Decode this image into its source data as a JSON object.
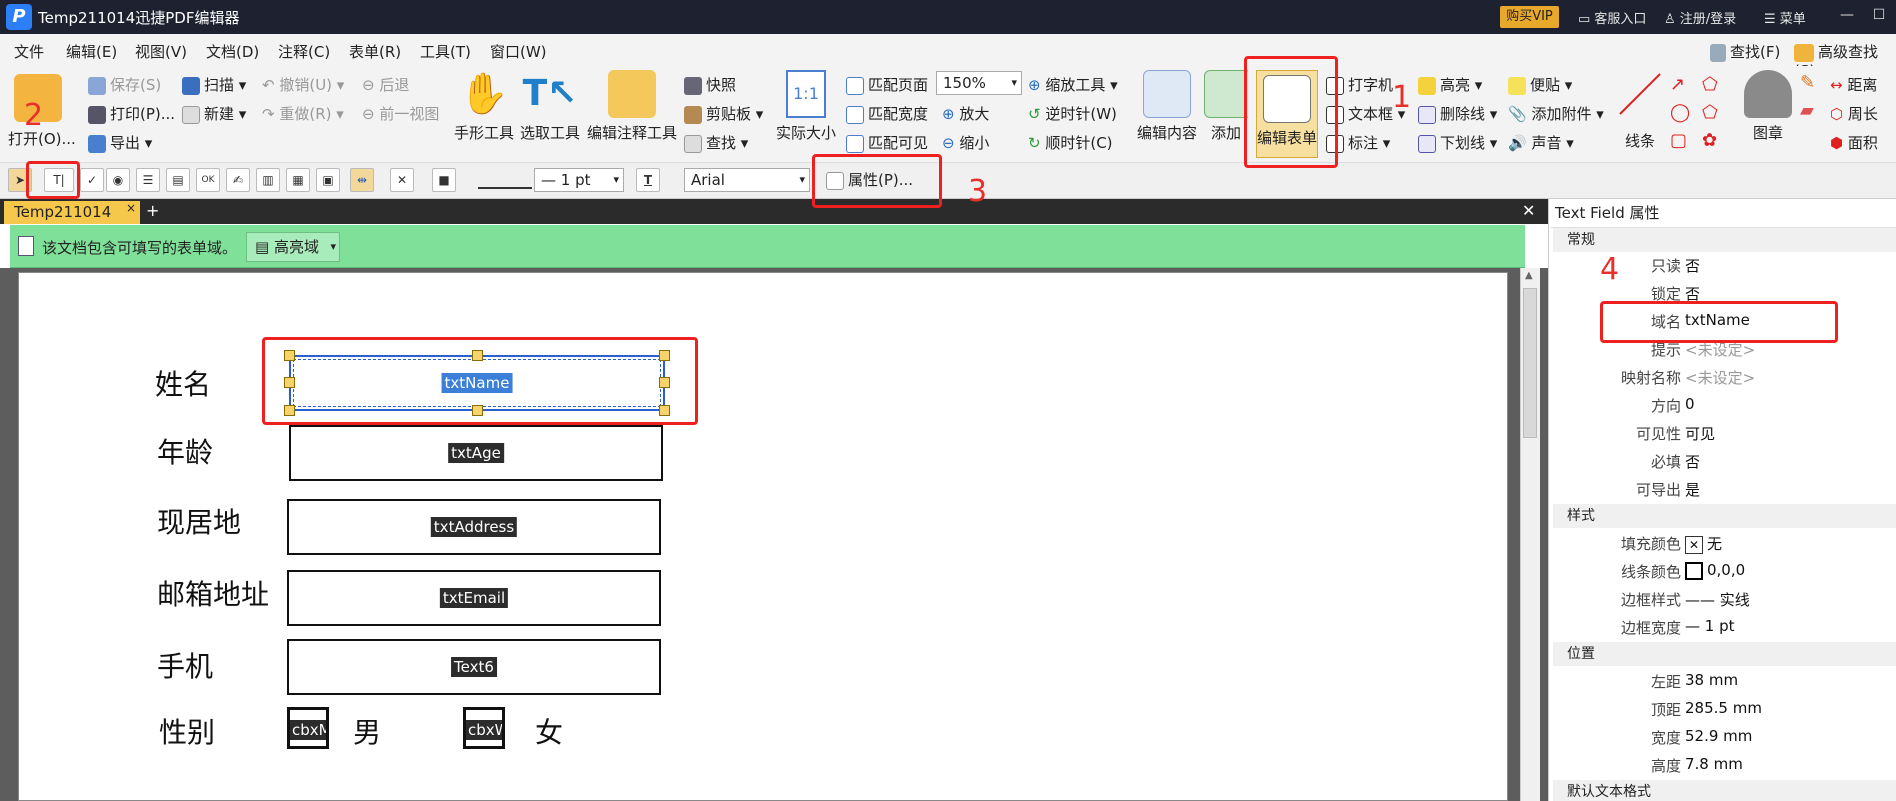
{
  "app": {
    "logo": "P",
    "title": "Temp211014迅捷PDF编辑器",
    "vip": "购买VIP",
    "service": "客服入口",
    "login": "注册/登录",
    "menu": "菜单"
  },
  "menubar": [
    "文件",
    "编辑(E)",
    "视图(V)",
    "文档(D)",
    "注释(C)",
    "表单(R)",
    "工具(T)",
    "窗口(W)"
  ],
  "menubar_right": {
    "find": "查找(F)",
    "adv_find": "高级查找(S)"
  },
  "ribbon": {
    "open": "打开(O)...",
    "save": "保存(S)",
    "print": "打印(P)...",
    "export": "导出",
    "scan": "扫描",
    "new": "新建",
    "undo": "撤销(U)",
    "redo": "重做(R)",
    "back": "后退",
    "prev_view": "前一视图",
    "hand": "手形工具",
    "select": "选取工具",
    "annot_select": "编辑注释工具",
    "snapshot": "快照",
    "clipboard": "剪贴板",
    "search": "查找",
    "actual": "实际大小",
    "fit_page": "匹配页面",
    "fit_width": "匹配宽度",
    "fit_visible": "匹配可见",
    "zoom": "150%",
    "zoom_tool": "缩放工具",
    "zoom_in": "放大",
    "zoom_out": "缩小",
    "ccw": "逆时针(W)",
    "cw": "顺时针(C)",
    "edit_content": "编辑内容",
    "add": "添加",
    "edit_form": "编辑表单",
    "typewriter": "打字机",
    "textbox": "文本框",
    "callout": "标注",
    "highlight": "高亮",
    "strike": "删除线",
    "underline": "下划线",
    "note": "便贴",
    "attach": "添加附件",
    "sound": "声音",
    "line": "线条",
    "stamp": "图章",
    "distance": "距离",
    "perimeter": "周长",
    "area": "面积"
  },
  "fmtbar": {
    "line_width": "— 1 pt",
    "font": "Arial",
    "properties": "属性(P)..."
  },
  "doc": {
    "tab": "Temp211014",
    "notice": "该文档包含可填写的表单域。",
    "highlight_btn": "高亮域",
    "labels": [
      "姓名",
      "年龄",
      "现居地",
      "邮箱地址",
      "手机",
      "性别"
    ],
    "fields": [
      "txtName",
      "txtAge",
      "txtAddress",
      "txtEmail",
      "Text6"
    ],
    "checkboxes": [
      "cbxM",
      "cbxW"
    ],
    "genders": [
      "男",
      "女"
    ]
  },
  "annotations": [
    "1",
    "2",
    "3",
    "4"
  ],
  "props": {
    "title": "Text Field 属性",
    "sections": [
      "常规",
      "样式",
      "位置",
      "默认文本格式"
    ],
    "general": [
      {
        "k": "只读",
        "v": "否"
      },
      {
        "k": "锁定",
        "v": "否"
      },
      {
        "k": "域名",
        "v": "txtName"
      },
      {
        "k": "提示",
        "v": "<未设定>"
      },
      {
        "k": "映射名称",
        "v": "<未设定>"
      },
      {
        "k": "方向",
        "v": "0"
      },
      {
        "k": "可见性",
        "v": "可见"
      },
      {
        "k": "必填",
        "v": "否"
      },
      {
        "k": "可导出",
        "v": "是"
      }
    ],
    "style": [
      {
        "k": "填充颜色",
        "v": "无"
      },
      {
        "k": "线条颜色",
        "v": "0,0,0"
      },
      {
        "k": "边框样式",
        "v": "—— 实线"
      },
      {
        "k": "边框宽度",
        "v": "— 1 pt"
      }
    ],
    "position": [
      {
        "k": "左距",
        "v": "38 mm"
      },
      {
        "k": "顶距",
        "v": "285.5 mm"
      },
      {
        "k": "宽度",
        "v": "52.9 mm"
      },
      {
        "k": "高度",
        "v": "7.8 mm"
      }
    ]
  },
  "colors": {
    "titlebar": "#1e2230",
    "notice": "#7fe09a",
    "annotation": "#ee2020",
    "tab": "#f5c84b"
  }
}
